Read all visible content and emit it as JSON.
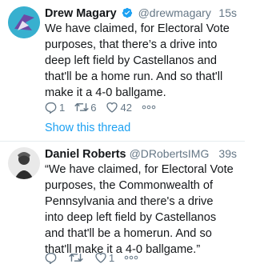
{
  "tweets": [
    {
      "name": "Drew Magary",
      "handle": "@drewmagary",
      "time": "15s",
      "verified": true,
      "text": "We have claimed, for Electoral Vote purposes, that there’s a drive into deep left field by Castellanos and that'll be a home run. And so that'll make it a 4-0 ballgame.",
      "replies": "1",
      "retweets": "6",
      "likes": "42",
      "show_thread": "Show this thread"
    },
    {
      "name": "Daniel Roberts",
      "handle": "@DRobertsIMG",
      "time": "39s",
      "verified": false,
      "text": "“We have claimed, for Electoral Vote purposes, the Commonwealth of Pennsylvania and there's a drive into deep left field by Castellanos and that'll be a homerun. And so that'll make it a 4-0 ballgame.”",
      "replies": "",
      "retweets": "",
      "likes": "1"
    }
  ],
  "colors": {
    "link": "#1da1f2",
    "muted": "#657786",
    "text": "#14171a"
  },
  "icons": [
    "reply-icon",
    "retweet-icon",
    "like-icon",
    "more-icon",
    "verified-icon"
  ]
}
